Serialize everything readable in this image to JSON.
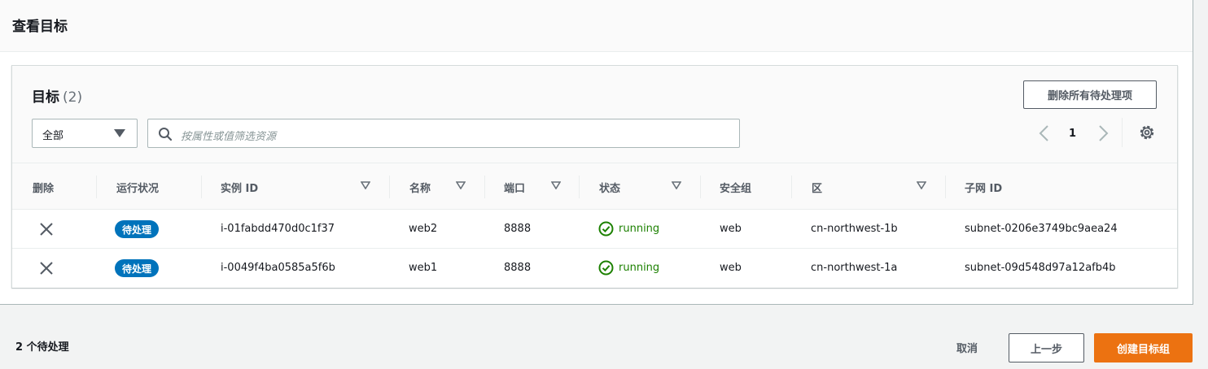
{
  "header": {
    "title": "查看目标"
  },
  "targets": {
    "title": "目标",
    "count": "(2)",
    "delete_all_label": "删除所有待处理项",
    "filter_select": {
      "value": "全部"
    },
    "search": {
      "placeholder": "按属性或值筛选资源"
    },
    "pagination": {
      "current_page": "1"
    }
  },
  "table": {
    "columns": [
      "删除",
      "运行状况",
      "实例 ID",
      "名称",
      "端口",
      "状态",
      "安全组",
      "区",
      "子网 ID"
    ],
    "rows": [
      {
        "health": "待处理",
        "instance_id": "i-01fabdd470d0c1f37",
        "name": "web2",
        "port": "8888",
        "state": "running",
        "security_group": "web",
        "zone": "cn-northwest-1b",
        "subnet_id": "subnet-0206e3749bc9aea24"
      },
      {
        "health": "待处理",
        "instance_id": "i-0049f4ba0585a5f6b",
        "name": "web1",
        "port": "8888",
        "state": "running",
        "security_group": "web",
        "zone": "cn-northwest-1a",
        "subnet_id": "subnet-09d548d97a12afb4b"
      }
    ]
  },
  "footer": {
    "pending_count": "2 个待处理",
    "cancel_label": "取消",
    "previous_label": "上一步",
    "create_label": "创建目标组"
  },
  "colors": {
    "primary": "#ec7211",
    "badge": "#0073bb",
    "running": "#1d8102"
  },
  "icons": [
    "search-icon",
    "chevron-left-icon",
    "chevron-right-icon",
    "gear-icon",
    "sort-icon",
    "remove-icon",
    "check-circle-icon"
  ]
}
